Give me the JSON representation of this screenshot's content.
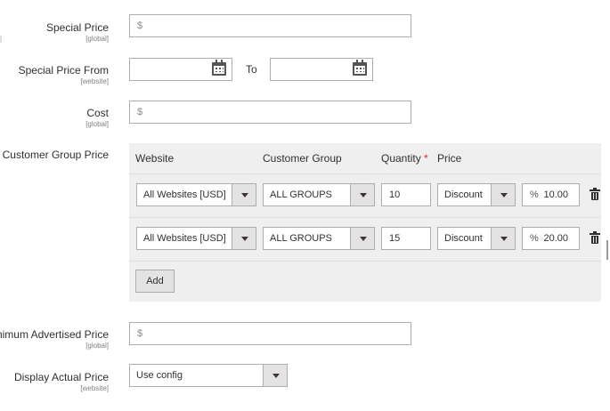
{
  "fields": {
    "special_price": {
      "label": "Special Price",
      "scope": "[global]",
      "prefix": "$",
      "value": ""
    },
    "special_price_from": {
      "label": "Special Price From",
      "scope": "[website]",
      "from_value": "",
      "to_label": "To",
      "to_value": ""
    },
    "cost": {
      "label": "Cost",
      "scope": "[global]",
      "prefix": "$",
      "value": ""
    },
    "customer_group_price": {
      "label": "Customer Group Price"
    },
    "minimum_advertised_price": {
      "label": "nimum Advertised Price",
      "scope": "[global]",
      "prefix": "$",
      "value": ""
    },
    "display_actual_price": {
      "label": "Display Actual Price",
      "scope": "[website]",
      "value": "Use config"
    }
  },
  "grid": {
    "headers": {
      "website": "Website",
      "customer_group": "Customer Group",
      "quantity": "Quantity",
      "required_mark": "*",
      "price": "Price"
    },
    "rows": [
      {
        "website": "All Websites [USD]",
        "group": "ALL GROUPS",
        "quantity": "10",
        "price_type": "Discount",
        "unit": "%",
        "price": "10.00"
      },
      {
        "website": "All Websites [USD]",
        "group": "ALL GROUPS",
        "quantity": "15",
        "price_type": "Discount",
        "unit": "%",
        "price": "20.00"
      }
    ],
    "add_label": "Add"
  },
  "colors": {
    "panel": "#efefef",
    "border": "#adadad",
    "required": "#e22626",
    "text": "#303030"
  }
}
